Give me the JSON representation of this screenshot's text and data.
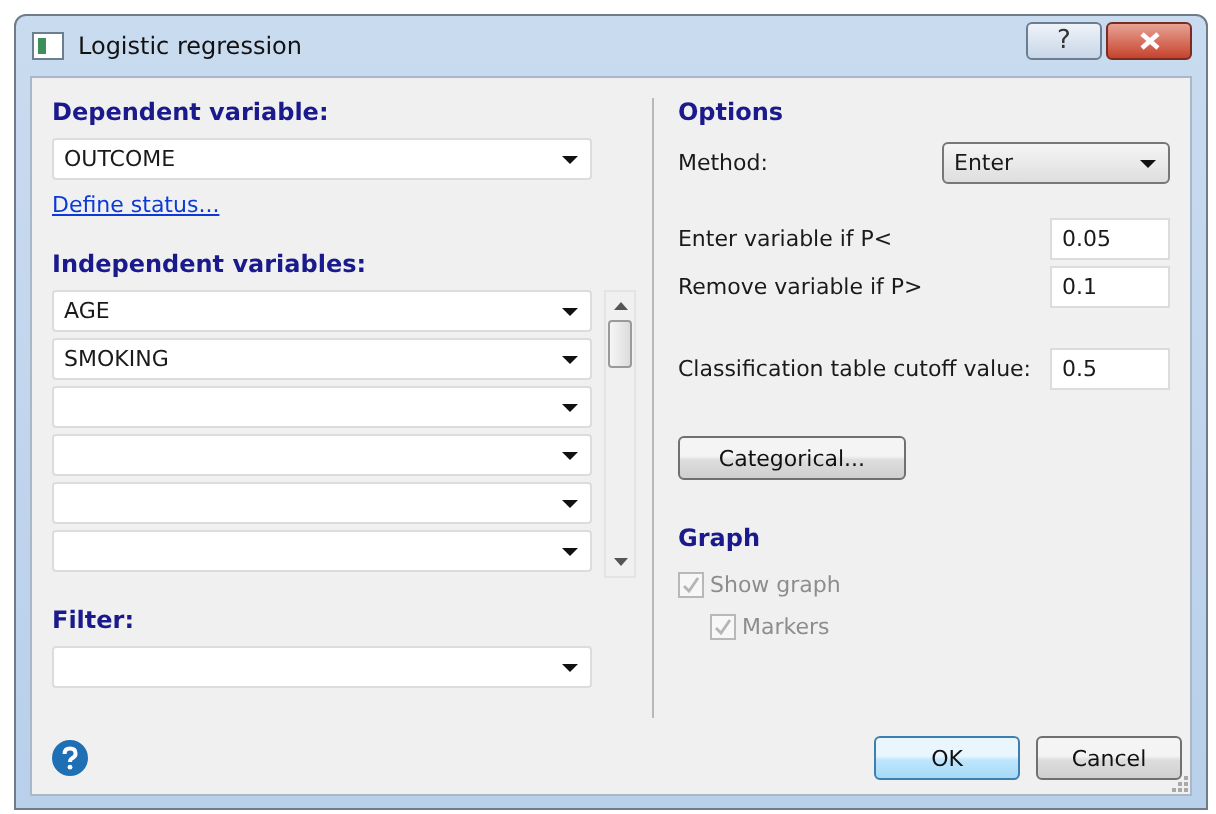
{
  "window": {
    "title": "Logistic regression",
    "buttons": [
      {
        "kind": "help",
        "label": "?"
      },
      {
        "kind": "close"
      }
    ]
  },
  "dependent": {
    "heading": "Dependent variable:",
    "value": "OUTCOME",
    "link": "Define status..."
  },
  "independent": {
    "heading": "Independent variables:",
    "items": [
      {
        "kind": "dropdown",
        "value": "AGE"
      },
      {
        "kind": "dropdown",
        "value": "SMOKING"
      },
      {
        "kind": "dropdown"
      },
      {
        "kind": "dropdown"
      },
      {
        "kind": "dropdown"
      },
      {
        "kind": "dropdown"
      }
    ]
  },
  "filter": {
    "heading": "Filter:"
  },
  "options": {
    "heading": "Options",
    "method_label": "Method:",
    "method": "Enter",
    "fields": [
      {
        "label": "Enter variable if P<",
        "value": "0.05"
      },
      {
        "label": "Remove variable if P>",
        "value": "0.1"
      },
      {
        "label": "Classification table cutoff value:",
        "value": "0.5"
      }
    ],
    "categorical_button": "Categorical..."
  },
  "graph": {
    "heading": "Graph",
    "checks": [
      {
        "label": "Show graph",
        "checked": true,
        "disabled": true,
        "children": [
          {
            "label": "Markers",
            "checked": true,
            "disabled": true
          }
        ]
      }
    ]
  },
  "footer": {
    "ok": "OK",
    "cancel": "Cancel"
  }
}
